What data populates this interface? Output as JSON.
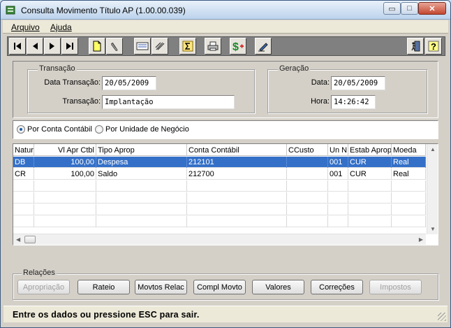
{
  "window": {
    "title": "Consulta Movimento Título AP (1.00.00.039)",
    "controls": {
      "minimize": "▭",
      "maximize": "□",
      "close": "✕"
    }
  },
  "menu": [
    "Arquivo",
    "Ajuda"
  ],
  "toolbar": {
    "icons": [
      "first-record-icon",
      "previous-record-icon",
      "next-record-icon",
      "last-record-icon",
      "new-document-icon",
      "clip-icon",
      "document-list-icon",
      "hand-tool-icon",
      "sum-icon",
      "print-icon",
      "dollar-add-icon",
      "pen-edit-icon",
      "exit-icon",
      "help-icon"
    ]
  },
  "transacao": {
    "title": "Transação",
    "data_label": "Data Transação:",
    "data_value": "20/05/2009",
    "transacao_label": "Transação:",
    "transacao_value": "Implantação"
  },
  "geracao": {
    "title": "Geração",
    "data_label": "Data:",
    "data_value": "20/05/2009",
    "hora_label": "Hora:",
    "hora_value": "14:26:42"
  },
  "radio": {
    "option1": "Por Conta Contábil",
    "option2": "Por Unidade de Negócio",
    "selected": "option1"
  },
  "table": {
    "columns": [
      "Natur",
      "Vl Apr Ctbl",
      "Tipo Aprop",
      "Conta Contábil",
      "CCusto",
      "Un N",
      "Estab Aprop",
      "Moeda"
    ],
    "rows": [
      [
        "DB",
        "100,00",
        "Despesa",
        "212101",
        "",
        "001",
        "CUR",
        "Real"
      ],
      [
        "CR",
        "100,00",
        "Saldo",
        "212700",
        "",
        "001",
        "CUR",
        "Real"
      ]
    ],
    "selected_row": 0
  },
  "relacoes": {
    "title": "Relações",
    "buttons": {
      "apropriacao": "Apropriação",
      "rateio": "Rateio",
      "movtos_relac": "Movtos Relac",
      "compl_movto": "Compl Movto",
      "valores": "Valores",
      "correcoes": "Correções",
      "impostos": "Impostos"
    }
  },
  "status": "Entre os dados ou pressione ESC para sair."
}
